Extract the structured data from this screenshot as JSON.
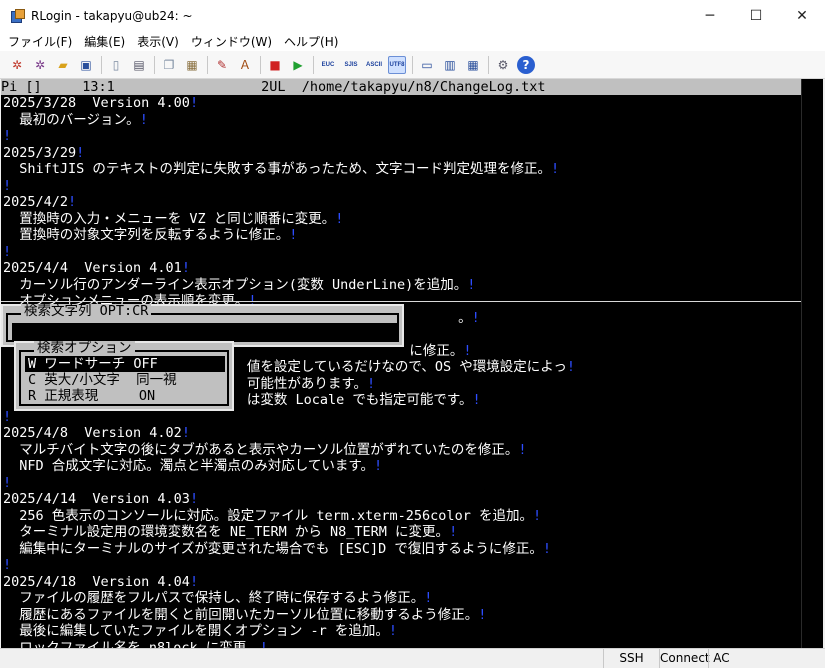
{
  "window": {
    "title": "RLogin - takapyu@ub24: ~",
    "minimize": "─",
    "maximize": "☐",
    "close": "✕"
  },
  "menu": [
    "ファイル(F)",
    "編集(E)",
    "表示(V)",
    "ウィンドウ(W)",
    "ヘルプ(H)"
  ],
  "toolbar": {
    "encodings": [
      "EUC",
      "SJIS",
      "ASCII",
      "UTF8"
    ],
    "selected_encoding": "UTF8"
  },
  "terminal": {
    "status_line": "Pi []     13:1                  2UL  /home/takapyu/n8/ChangeLog.txt",
    "lines": [
      {
        "text": "2025/3/28  Version 4.00",
        "eol": "!"
      },
      {
        "text": "  最初のバージョン。",
        "eol": "!"
      },
      {
        "text": "",
        "eol": "!"
      },
      {
        "text": "2025/3/29",
        "eol": "!"
      },
      {
        "text": "  ShiftJIS のテキストの判定に失敗する事があったため、文字コード判定処理を修正。",
        "eol": "!"
      },
      {
        "text": "",
        "eol": "!"
      },
      {
        "text": "2025/4/2",
        "eol": "!"
      },
      {
        "text": "  置換時の入力・メニューを VZ と同じ順番に変更。",
        "eol": "!"
      },
      {
        "text": "  置換時の対象文字列を反転するように修正。",
        "eol": "!"
      },
      {
        "text": "",
        "eol": "!"
      },
      {
        "text": "2025/4/4  Version 4.01",
        "eol": "!"
      },
      {
        "text": "  カーソル行のアンダーライン表示オプション(変数 UnderLine)を追加。",
        "eol": "!"
      },
      {
        "text": "  オプションメニューの表示順を変更。",
        "eol": "!"
      },
      {
        "text": "                                                        。",
        "eol": "!"
      },
      {
        "text": "",
        "eol": ""
      },
      {
        "text": "                                                  に修正。",
        "eol": "!"
      },
      {
        "text": "                              値を設定しているだけなので、OS や環境設定によっ",
        "eol": "!"
      },
      {
        "text": "                              可能性があります。",
        "eol": "!"
      },
      {
        "text": "                              は変数 Locale でも指定可能です。",
        "eol": "!"
      },
      {
        "text": "",
        "eol": "!"
      },
      {
        "text": "2025/4/8  Version 4.02",
        "eol": "!"
      },
      {
        "text": "  マルチバイト文字の後にタブがあると表示やカーソル位置がずれていたのを修正。",
        "eol": "!"
      },
      {
        "text": "  NFD 合成文字に対応。濁点と半濁点のみ対応しています。",
        "eol": "!"
      },
      {
        "text": "",
        "eol": "!"
      },
      {
        "text": "2025/4/14  Version 4.03",
        "eol": "!"
      },
      {
        "text": "  256 色表示のコンソールに対応。設定ファイル term.xterm-256color を追加。",
        "eol": "!"
      },
      {
        "text": "  ターミナル設定用の環境変数名を NE_TERM から N8_TERM に変更。",
        "eol": "!"
      },
      {
        "text": "  編集中にターミナルのサイズが変更された場合でも [ESC]D で復旧するように修正。",
        "eol": "!"
      },
      {
        "text": "",
        "eol": "!"
      },
      {
        "text": "2025/4/18  Version 4.04",
        "eol": "!"
      },
      {
        "text": "  ファイルの履歴をフルパスで保持し、終了時に保存するよう修正。",
        "eol": "!"
      },
      {
        "text": "  履歴にあるファイルを開くと前回開いたカーソル位置に移動するよう修正。",
        "eol": "!"
      },
      {
        "text": "  最後に編集していたファイルを開くオプション -r を追加。",
        "eol": "!"
      },
      {
        "text": "  ロックファイル名を n8lock に変更。",
        "eol": "!"
      }
    ]
  },
  "search_dialog": {
    "title": "検索文字列 OPT:CR",
    "value": ""
  },
  "options_dialog": {
    "title": "検索オプション",
    "items": [
      {
        "label": "W ワードサーチ OFF"
      },
      {
        "label": "C 英大/小文字  同一視"
      },
      {
        "label": "R 正規表現     ON"
      }
    ]
  },
  "statusbar": {
    "protocol": "SSH",
    "connection": "Connect",
    "ac": "AC"
  },
  "colors": {
    "terminal_bg": "#000000",
    "terminal_fg": "#ffffff",
    "eol_marker": "#2d4dff",
    "dialog_bg": "#c0c0c0"
  }
}
